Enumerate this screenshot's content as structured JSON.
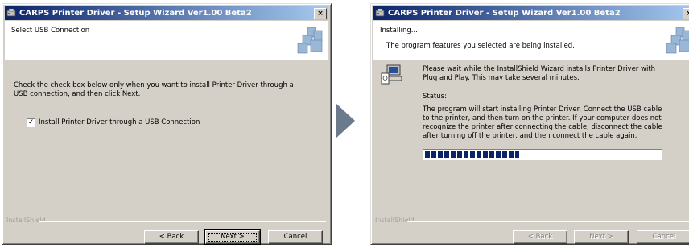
{
  "window_title": "CARPS Printer Driver - Setup Wizard Ver1.00 Beta2",
  "close_label": "×",
  "brand": "InstallShield",
  "accent_colors": {
    "title_start": "#0a246a",
    "title_end": "#a6caf0",
    "arrow": "#6b7b8c"
  },
  "step1": {
    "header_title": "Select USB Connection",
    "instruction": "Check the check box below only when you want to install Printer Driver through a USB connection, and then click Next.",
    "checkbox_checked": true,
    "checkbox_mark": "✓",
    "checkbox_label": "Install Printer Driver through a USB Connection",
    "buttons": {
      "back": "< Back",
      "next": "Next >",
      "cancel": "Cancel"
    }
  },
  "step2": {
    "header_title": "Installing...",
    "header_subtitle": "The program features you selected are being installed.",
    "wait_text": "Please wait while the InstallShield Wizard installs Printer Driver with Plug and Play. This may take several minutes.",
    "status_label": "Status:",
    "status_text": "The program will start installing Printer Driver. Connect the USB cable to the printer, and then turn on the printer. If your computer does not recognize the printer after connecting the cable, disconnect the cable after turning off the printer, and then connect the cable again.",
    "progress": 0.4,
    "buttons": {
      "back": "< Back",
      "next": "Next >",
      "cancel": "Cancel"
    }
  }
}
